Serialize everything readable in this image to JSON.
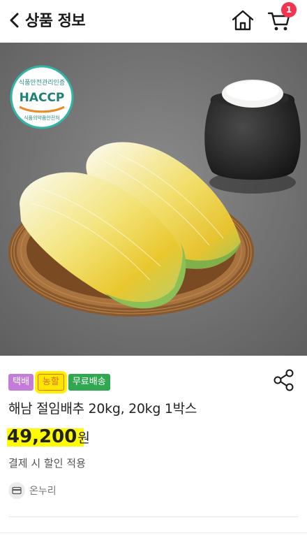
{
  "header": {
    "title": "상품 정보",
    "back_icon": "chevron-left-icon",
    "home_icon": "home-icon",
    "cart_icon": "cart-icon",
    "cart_count": "1",
    "badge_color": "#f2344f"
  },
  "hero": {
    "haccp_badge": {
      "top_text": "식품안전관리인증",
      "main_text": "HACCP",
      "bottom_text": "식품의약품안전처"
    }
  },
  "product": {
    "tags": [
      {
        "label": "택배",
        "color": "#c47bd9"
      },
      {
        "label": "농할",
        "color": "#e26b1a"
      },
      {
        "label": "무료배송",
        "color": "#2fa84f"
      }
    ],
    "name": "해남 절임배추 20kg, 20kg 1박스",
    "price": "49,200",
    "currency": "원",
    "discount_note": "결제 시 할인 적용",
    "payment_option": "온누리",
    "share_icon": "share-icon"
  }
}
